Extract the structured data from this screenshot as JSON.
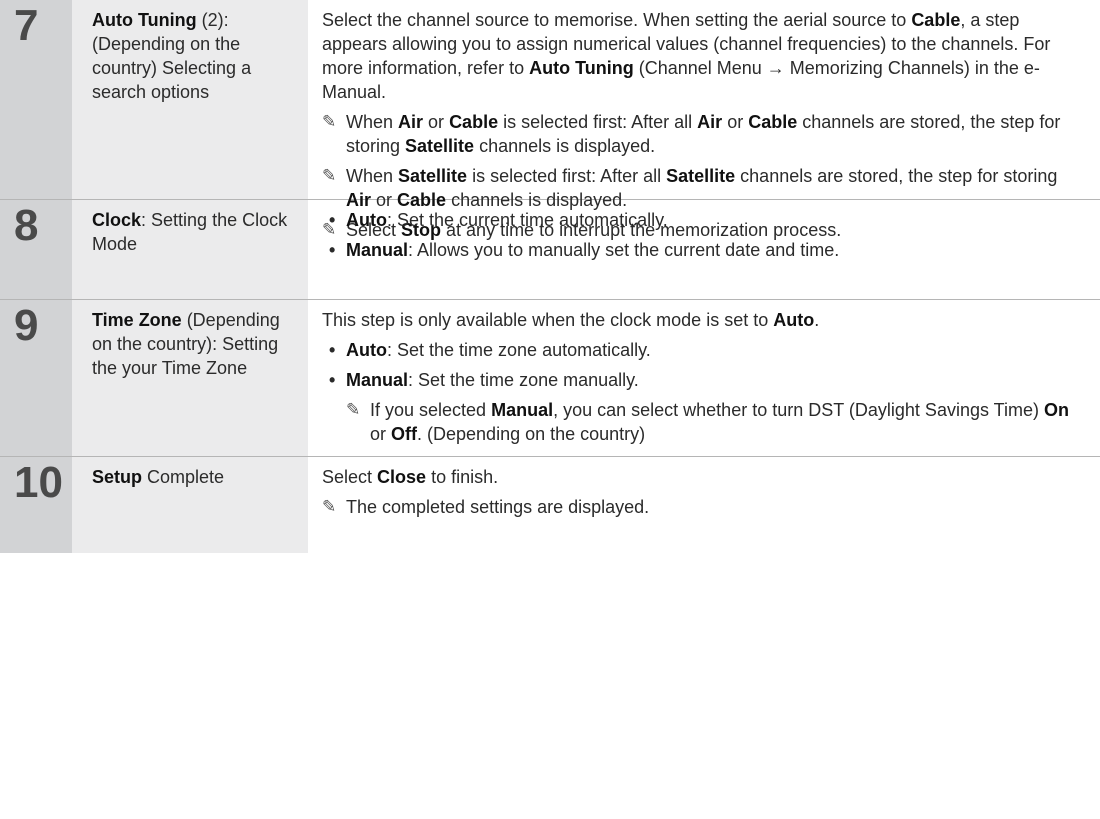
{
  "rows": [
    {
      "number": "7",
      "title": {
        "bold": "Auto Tuning",
        "rest": " (2): (Depending on the country) Selecting a search options"
      },
      "intro": {
        "t1": "Select the channel source to memorise. When setting the aerial source to ",
        "b1": "Cable",
        "t2": ", a step appears allowing you to assign numerical values (channel frequencies) to the channels. For more information, refer to ",
        "b2": "Auto Tuning",
        "t3": " (Channel Menu → Memorizing Channels) in the e-Manual."
      },
      "notes": [
        {
          "t1": "When ",
          "b1": "Air",
          "t2": " or ",
          "b2": "Cable",
          "t3": " is selected first: After all ",
          "b3": "Air",
          "t4": " or ",
          "b4": "Cable",
          "t5": " channels are stored, the step for storing ",
          "b5": "Satellite",
          "t6": " channels is displayed."
        },
        {
          "t1": "When ",
          "b1": "Satellite",
          "t2": " is selected first: After all ",
          "b2": "Satellite",
          "t3": " channels are stored, the step for storing ",
          "b3": "Air",
          "t4": " or ",
          "b4": "Cable",
          "t5": " channels is displayed."
        },
        {
          "t1": "Select ",
          "b1": "Stop",
          "t2": " at any time to interrupt the memorization process."
        }
      ]
    },
    {
      "number": "8",
      "title": {
        "bold": "Clock",
        "rest": ": Setting the Clock Mode"
      },
      "bullets": [
        {
          "bold": "Auto",
          "rest": ": Set the current time automatically."
        },
        {
          "bold": "Manual",
          "rest": ": Allows you to manually set the current date and time."
        }
      ]
    },
    {
      "number": "9",
      "title": {
        "bold": "Time Zone",
        "rest": " (Depending on the country): Setting the your Time Zone"
      },
      "intro": {
        "t1": "This step is only available when the clock mode is set to ",
        "b1": "Auto",
        "t2": "."
      },
      "bullets": [
        {
          "bold": "Auto",
          "rest": ": Set the time zone automatically."
        },
        {
          "bold": "Manual",
          "rest": ": Set the time zone manually."
        }
      ],
      "subnote": {
        "t1": "If you selected ",
        "b1": "Manual",
        "t2": ", you can select whether to turn DST (Daylight Savings Time) ",
        "b2": "On",
        "t3": " or ",
        "b3": "Off",
        "t4": ". (Depending on the country)"
      }
    },
    {
      "number": "10",
      "title": {
        "bold": "Setup",
        "rest": " Complete"
      },
      "intro": {
        "t1": "Select ",
        "b1": "Close",
        "t2": " to finish."
      },
      "notes": [
        {
          "t1": "The completed settings are displayed."
        }
      ]
    }
  ],
  "icons": {
    "note": "pencil-note-icon",
    "bullet": "bullet-dot"
  }
}
